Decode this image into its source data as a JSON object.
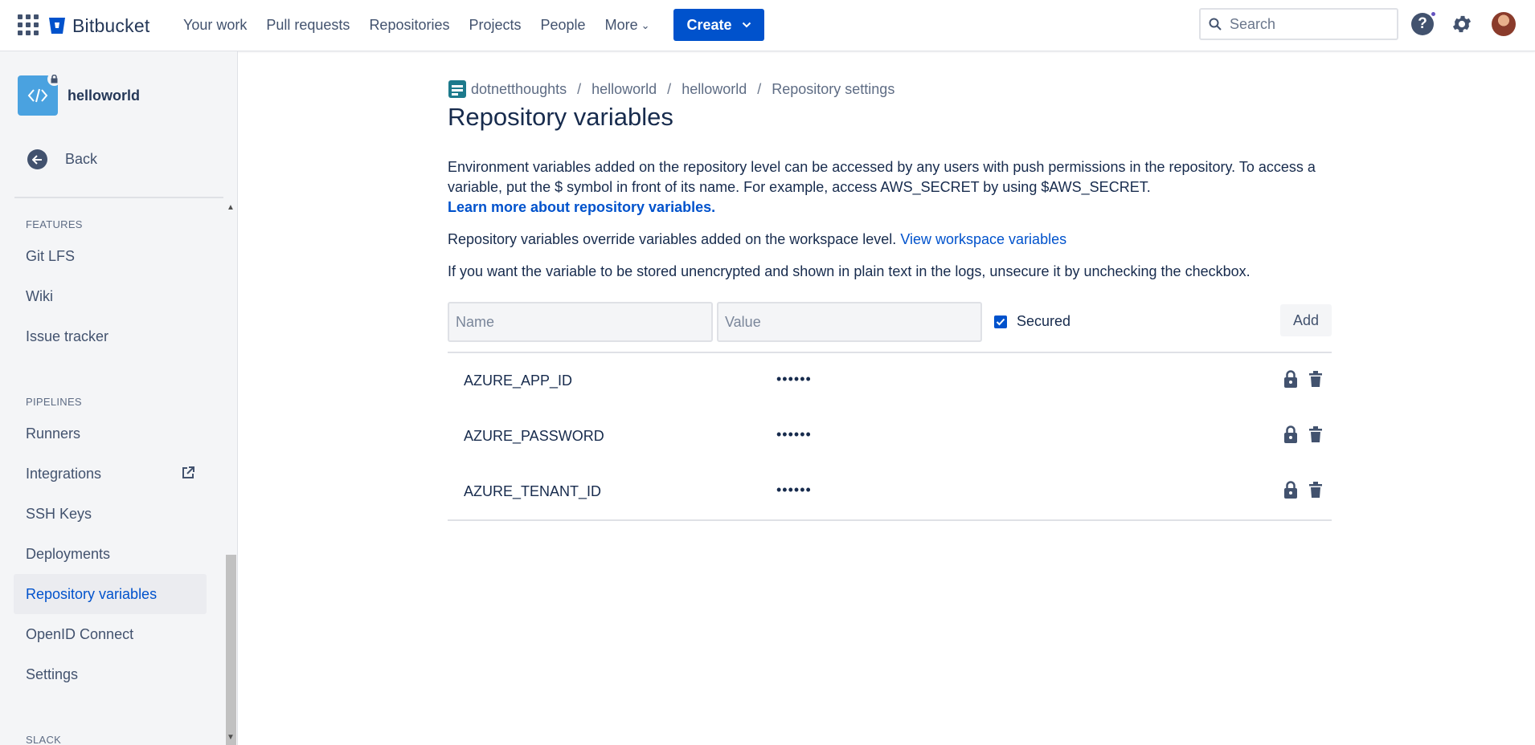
{
  "nav": {
    "brand": "Bitbucket",
    "items": [
      "Your work",
      "Pull requests",
      "Repositories",
      "Projects",
      "People"
    ],
    "more_label": "More",
    "create_label": "Create",
    "search_placeholder": "Search",
    "help_label": "?"
  },
  "sidebar": {
    "repo_name": "helloworld",
    "back_label": "Back",
    "sections": {
      "features": "FEATURES",
      "pipelines": "PIPELINES",
      "slack": "SLACK"
    },
    "features_items": [
      "Git LFS",
      "Wiki",
      "Issue tracker"
    ],
    "pipelines_items": [
      "Runners",
      "Integrations",
      "SSH Keys",
      "Deployments",
      "Repository variables",
      "OpenID Connect",
      "Settings"
    ],
    "active_item": "Repository variables"
  },
  "breadcrumb": [
    "dotnetthoughts",
    "helloworld",
    "helloworld",
    "Repository settings"
  ],
  "page": {
    "title": "Repository variables",
    "desc1": "Environment variables added on the repository level can be accessed by any users with push permissions in the repository. To access a variable, put the $ symbol in front of its name. For example, access AWS_SECRET by using $AWS_SECRET.",
    "learn_more": "Learn more about repository variables.",
    "desc2": "Repository variables override variables added on the workspace level.",
    "workspace_link": "View workspace variables",
    "desc3": "If you want the variable to be stored unencrypted and shown in plain text in the logs, unsecure it by unchecking the checkbox."
  },
  "form": {
    "name_placeholder": "Name",
    "value_placeholder": "Value",
    "secured_label": "Secured",
    "secured_checked": true,
    "add_label": "Add"
  },
  "variables": [
    {
      "name": "AZURE_APP_ID",
      "value": "••••••"
    },
    {
      "name": "AZURE_PASSWORD",
      "value": "••••••"
    },
    {
      "name": "AZURE_TENANT_ID",
      "value": "••••••"
    }
  ],
  "colors": {
    "primary": "#0052cc",
    "text": "#172b4d",
    "sidebar_bg": "#f4f5f7",
    "repo_avatar": "#4aa2e0"
  }
}
